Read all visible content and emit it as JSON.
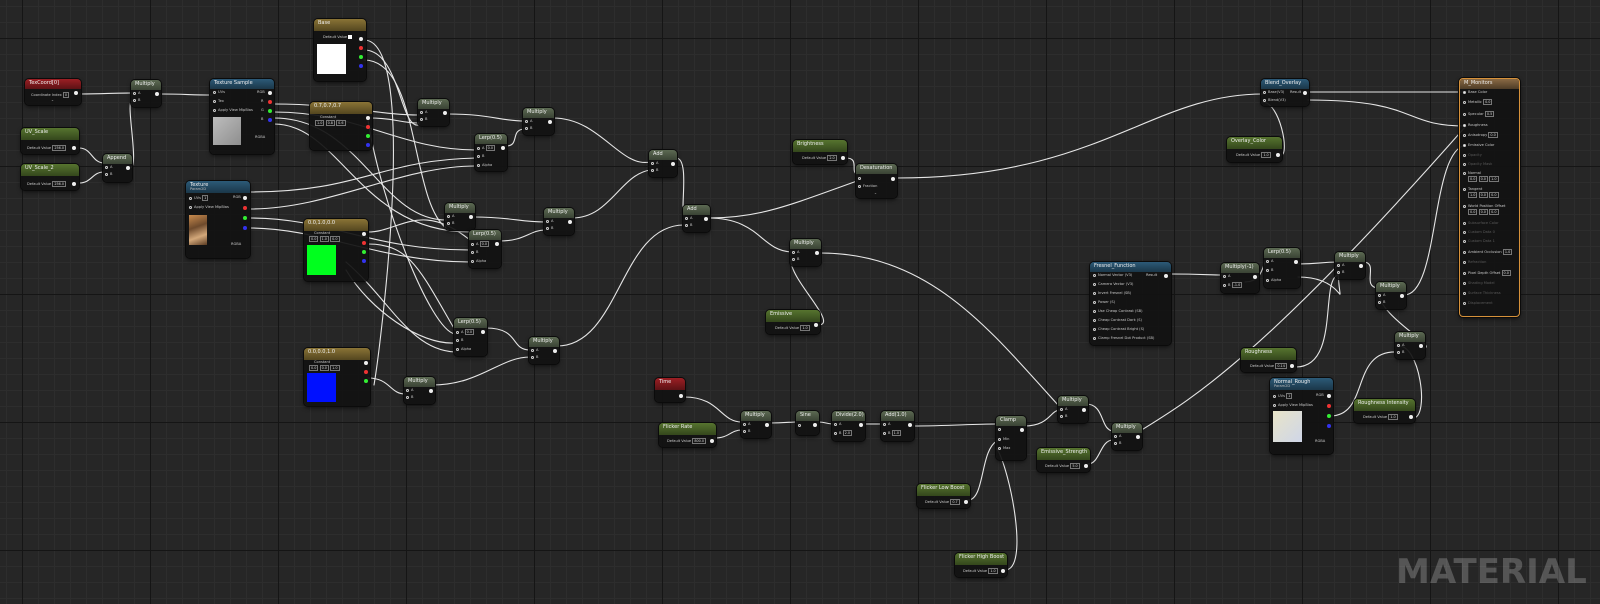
{
  "watermark": "MATERIAL",
  "colors": {
    "wire": "#e6e6e6",
    "white_swatch": "#ffffff",
    "green_swatch": "#00ff1e",
    "blue_swatch": "#0010ff",
    "selected_border": "#d6913a"
  },
  "common": {
    "default_value": "Default Value",
    "constant": "Constant",
    "a": "A",
    "b": "B",
    "alpha": "Alpha",
    "uvs": "UVs",
    "tex": "Tex",
    "apply_view_mipbias": "Apply View MipBias",
    "rgb": "RGB",
    "r": "R",
    "g": "G",
    "rgba": "RGBA",
    "min": "Min",
    "max": "Max",
    "arrow": "⌄"
  },
  "nodes": {
    "texcoord": {
      "title": "TexCoord[0]",
      "coord_index_label": "Coordinate Index",
      "coord_index": "0"
    },
    "uv_scale_1": {
      "title": "UV_Scale",
      "value": "256.0"
    },
    "uv_scale_2": {
      "title": "UV_Scale_2",
      "value": "256.0"
    },
    "append": {
      "title": "Append"
    },
    "multiply_uv": {
      "title": "Multiply"
    },
    "texture_sample": {
      "title": "Texture Sample"
    },
    "texture_param": {
      "title": "Texture",
      "subtitle": "Param2D",
      "uvs_value": "1"
    },
    "vector_white": {
      "title": "Base"
    },
    "const3_top": {
      "title": "0.7,0.7,0.7",
      "values": [
        "1.0",
        "0.8",
        "0.6"
      ]
    },
    "const3_green": {
      "title": "0.0,1.0,0.0",
      "values": [
        "0.0",
        "1.0",
        "0.0"
      ]
    },
    "const3_blue": {
      "title": "0.0,0.0,1.0",
      "values": [
        "0.0",
        "0.0",
        "1.0"
      ]
    },
    "multiply_a": {
      "title": "Multiply"
    },
    "multiply_b": {
      "title": "Multiply"
    },
    "multiply_c": {
      "title": "Multiply"
    },
    "multiply_d": {
      "title": "Multiply"
    },
    "multiply_e": {
      "title": "Multiply"
    },
    "multiply_f": {
      "title": "Multiply"
    },
    "lerp_1": {
      "title": "Lerp(0.5)",
      "a": "0.0"
    },
    "lerp_2": {
      "title": "Lerp(0.5)",
      "a": "0.0"
    },
    "lerp_3": {
      "title": "Lerp(0.5)",
      "a": "0.0"
    },
    "add_1": {
      "title": "Add"
    },
    "add_2": {
      "title": "Add"
    },
    "brightness": {
      "title": "Brightness",
      "value": "2.0"
    },
    "emissive_param": {
      "title": "Emissive",
      "value": "1.0"
    },
    "desaturation": {
      "title": "Desaturation",
      "fraction": "Fraction"
    },
    "blend_overlay": {
      "title": "Blend_Overlay",
      "base": "Base(V3)",
      "blend": "Blend(V3)",
      "result": "Result"
    },
    "overlay_color": {
      "title": "Overlay_Color",
      "value": "1.0"
    },
    "fresnel": {
      "title": "Fresnel_Function",
      "result": "Result",
      "inputs": [
        "Normal Vector (V3)",
        "Camera Vector (V3)",
        "Invert Fresnel (SB)",
        "Power (S)",
        "Use Cheap Contrast (SB)",
        "Cheap Contrast Dark (S)",
        "Cheap Contrast Bright (S)",
        "Clamp Fresnel Dot Product (SB)"
      ]
    },
    "multiply_fres": {
      "title": "Multiply(-1)",
      "b": "-1.0"
    },
    "lerp_fres": {
      "title": "Lerp(0.5)"
    },
    "multiply_g": {
      "title": "Multiply"
    },
    "multiply_h": {
      "title": "Multiply"
    },
    "multiply_i": {
      "title": "Multiply"
    },
    "multiply_j": {
      "title": "Multiply"
    },
    "multiply_k": {
      "title": "Multiply"
    },
    "roughness": {
      "title": "Roughness",
      "value": "0.14"
    },
    "normal_tex": {
      "title": "Normal_Rough",
      "subtitle": "Param2D",
      "uvs_value": "1"
    },
    "rough_intensity": {
      "title": "Roughness Intensity",
      "value": "1.0"
    },
    "time": {
      "title": "Time"
    },
    "flicker_rate": {
      "title": "Flicker Rate",
      "value": "800.0"
    },
    "multiply_time": {
      "title": "Multiply"
    },
    "sine": {
      "title": "Sine"
    },
    "divide": {
      "title": "Divide(2.0)",
      "b": "2.0"
    },
    "add_half": {
      "title": "Add(1.0)",
      "b": "1.0"
    },
    "clamp": {
      "title": "Clamp"
    },
    "flicker_low": {
      "title": "Flicker Low Boost",
      "value": "0.7"
    },
    "flicker_high": {
      "title": "Flicker High Boost",
      "value": "1.0"
    },
    "emissive_strength": {
      "title": "Emissive_Strength",
      "value": "5.0"
    },
    "material_output": {
      "title": "M_Monitors",
      "pins": [
        "Base Color",
        "Metallic",
        "Specular",
        "Roughness",
        "Anisotropy",
        "Emissive Color",
        "Opacity",
        "Opacity Mask",
        "Normal",
        "Tangent",
        "World Position Offset",
        "Subsurface Color",
        "Custom Data 0",
        "Custom Data 1",
        "Ambient Occlusion",
        "Refraction",
        "Pixel Depth Offset",
        "Shading Model",
        "Surface Thickness",
        "Displacement"
      ],
      "metallic": "0.0",
      "specular": "0.5",
      "anisotropy": "0.0",
      "ao": "1.0",
      "pdo": "0.0",
      "normal_vals": [
        "0.0",
        "0.0",
        "1.0"
      ],
      "tangent_vals": [
        "1.0",
        "0.0",
        "0.0"
      ],
      "wpo_vals": [
        "0.0",
        "0.0",
        "0.0"
      ]
    }
  }
}
